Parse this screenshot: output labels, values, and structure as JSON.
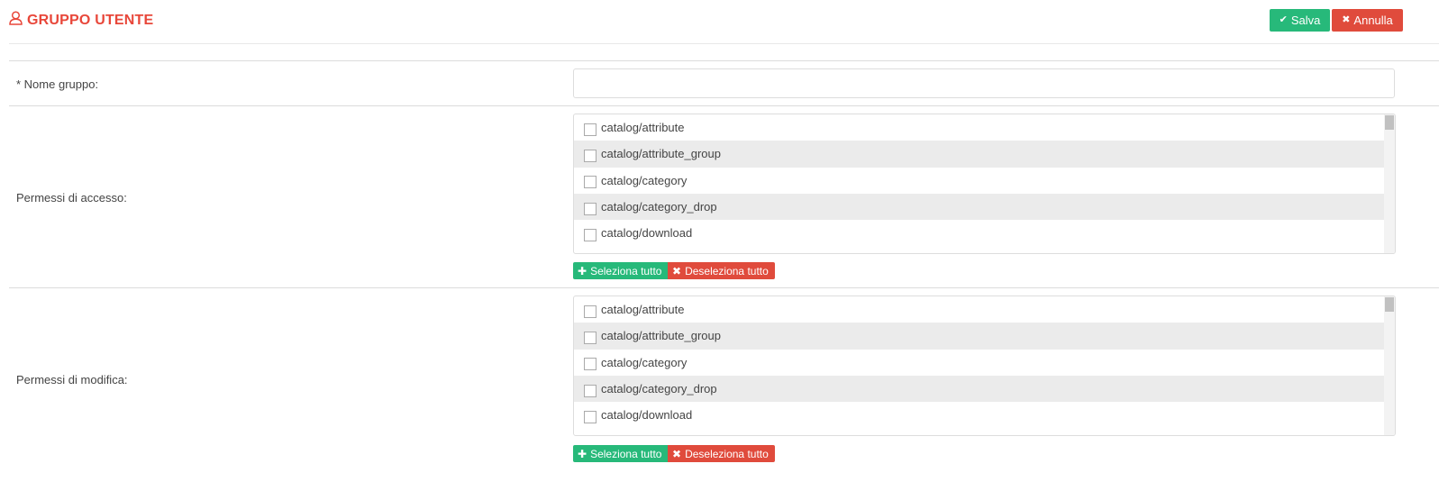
{
  "header": {
    "title": "GRUPPO UTENTE",
    "title_icon": "user-outline-icon",
    "save_label": "Salva",
    "cancel_label": "Annulla"
  },
  "form": {
    "name_label": "* Nome gruppo:",
    "name_value": "",
    "access_label": "Permessi di accesso:",
    "modify_label": "Permessi di modifica:",
    "select_all_label": "Seleziona tutto",
    "deselect_all_label": "Deseleziona tutto",
    "access_items": [
      {
        "label": "catalog/attribute",
        "checked": false
      },
      {
        "label": "catalog/attribute_group",
        "checked": false
      },
      {
        "label": "catalog/category",
        "checked": false
      },
      {
        "label": "catalog/category_drop",
        "checked": false
      },
      {
        "label": "catalog/download",
        "checked": false
      }
    ],
    "modify_items": [
      {
        "label": "catalog/attribute",
        "checked": false
      },
      {
        "label": "catalog/attribute_group",
        "checked": false
      },
      {
        "label": "catalog/category",
        "checked": false
      },
      {
        "label": "catalog/category_drop",
        "checked": false
      },
      {
        "label": "catalog/download",
        "checked": false
      }
    ]
  },
  "colors": {
    "accent_red": "#e8473a",
    "save_green": "#27b97a",
    "cancel_red": "#e04b3c"
  }
}
